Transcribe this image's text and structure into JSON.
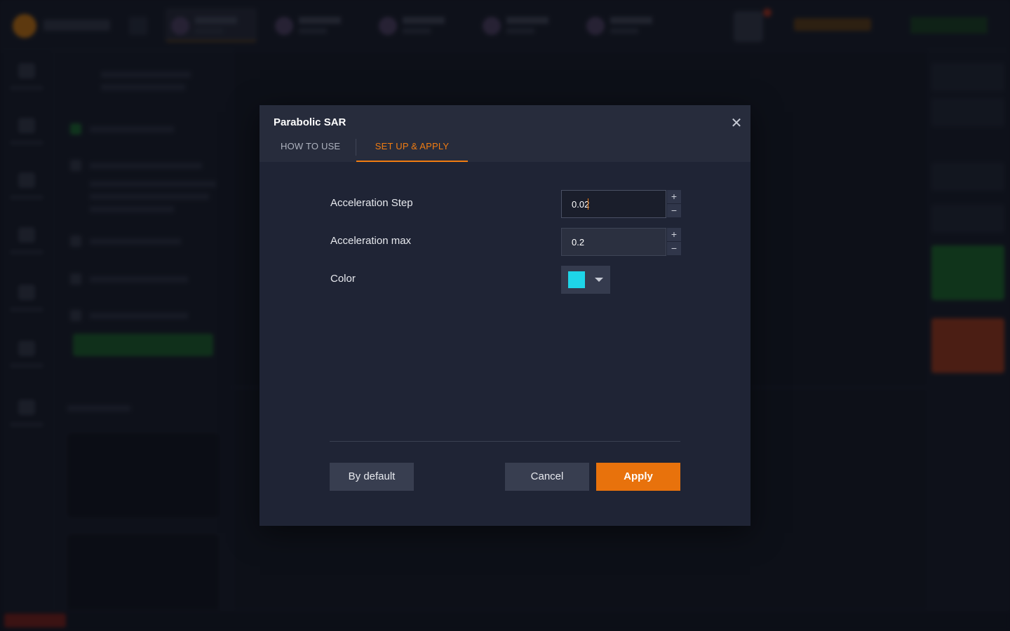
{
  "modal": {
    "title": "Parabolic SAR",
    "close_icon": "close-icon",
    "tabs": [
      {
        "label": "HOW TO USE",
        "active": false
      },
      {
        "label": "SET UP & APPLY",
        "active": true
      }
    ],
    "fields": [
      {
        "label": "Acceleration Step",
        "value": "0.02",
        "focused": true
      },
      {
        "label": "Acceleration max",
        "value": "0.2",
        "focused": false
      }
    ],
    "steppers": {
      "plus": "+",
      "minus": "−"
    },
    "color": {
      "label": "Color",
      "value": "#1ed5e8"
    },
    "buttons": {
      "by_default": "By default",
      "cancel": "Cancel",
      "apply": "Apply"
    }
  },
  "colors": {
    "accent": "#f07c12",
    "apply_button": "#e8720c",
    "modal_bg": "#1f2435",
    "higher_button": "#1f7a2e",
    "lower_button": "#b8401c"
  }
}
